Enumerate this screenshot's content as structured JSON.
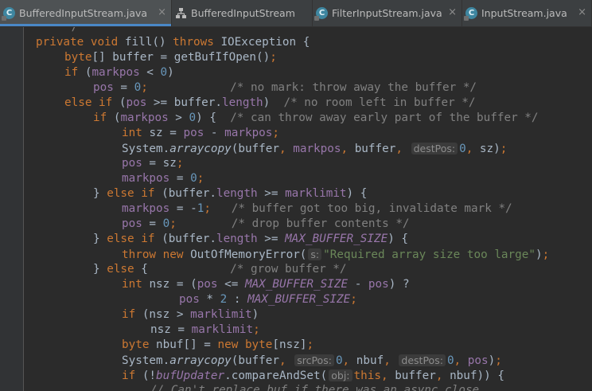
{
  "tabs": [
    {
      "label": "BufferedInputStream.java",
      "icon": "java-class-icon",
      "active": true,
      "closable": true
    },
    {
      "label": "BufferedInputStream",
      "icon": "hierarchy-icon",
      "active": false,
      "closable": false
    },
    {
      "label": "FilterInputStream.java",
      "icon": "java-class-icon",
      "active": false,
      "closable": true
    },
    {
      "label": "InputStream.java",
      "icon": "java-class-icon",
      "active": false,
      "closable": true
    }
  ],
  "close_glyph": "×",
  "colors": {
    "keyword": "#cc7832",
    "number": "#6897bb",
    "comment": "#808080",
    "string": "#6a8759",
    "field": "#9876aa",
    "text": "#a9b7c6",
    "background": "#2b2b2b"
  },
  "code": [
    {
      "indent": 2,
      "tokens": [
        {
          "t": "*/",
          "c": "cmt"
        }
      ]
    },
    {
      "indent": 1,
      "tokens": [
        {
          "t": "private void ",
          "c": "kw"
        },
        {
          "t": "fill() "
        },
        {
          "t": "throws ",
          "c": "kw"
        },
        {
          "t": "IOException {"
        }
      ]
    },
    {
      "indent": 2,
      "tokens": [
        {
          "t": "byte",
          "c": "kw"
        },
        {
          "t": "[] buffer = getBufIfOpen()"
        },
        {
          "t": ";",
          "c": "kw"
        }
      ]
    },
    {
      "indent": 2,
      "tokens": [
        {
          "t": "if ",
          "c": "kw"
        },
        {
          "t": "("
        },
        {
          "t": "markpos",
          "c": "field"
        },
        {
          "t": " < "
        },
        {
          "t": "0",
          "c": "num"
        },
        {
          "t": ")"
        }
      ]
    },
    {
      "indent": 3,
      "tokens": [
        {
          "t": "pos",
          "c": "field"
        },
        {
          "t": " = "
        },
        {
          "t": "0",
          "c": "num"
        },
        {
          "t": ";",
          "c": "kw"
        },
        {
          "t": "            "
        },
        {
          "t": "/* no mark: throw away the buffer */",
          "c": "cmt"
        }
      ]
    },
    {
      "indent": 2,
      "tokens": [
        {
          "t": "else if ",
          "c": "kw"
        },
        {
          "t": "("
        },
        {
          "t": "pos",
          "c": "field"
        },
        {
          "t": " >= buffer."
        },
        {
          "t": "length",
          "c": "field"
        },
        {
          "t": ")  "
        },
        {
          "t": "/* no room left in buffer */",
          "c": "cmt"
        }
      ]
    },
    {
      "indent": 3,
      "tokens": [
        {
          "t": "if ",
          "c": "kw"
        },
        {
          "t": "("
        },
        {
          "t": "markpos",
          "c": "field"
        },
        {
          "t": " > "
        },
        {
          "t": "0",
          "c": "num"
        },
        {
          "t": ") {  "
        },
        {
          "t": "/* can throw away early part of the buffer */",
          "c": "cmt"
        }
      ]
    },
    {
      "indent": 4,
      "tokens": [
        {
          "t": "int ",
          "c": "kw"
        },
        {
          "t": "sz = "
        },
        {
          "t": "pos",
          "c": "field"
        },
        {
          "t": " - "
        },
        {
          "t": "markpos",
          "c": "field"
        },
        {
          "t": ";",
          "c": "kw"
        }
      ]
    },
    {
      "indent": 4,
      "tokens": [
        {
          "t": "System."
        },
        {
          "t": "arraycopy",
          "c": "sm"
        },
        {
          "t": "(buffer"
        },
        {
          "t": ", ",
          "c": "kw"
        },
        {
          "t": "markpos",
          "c": "field"
        },
        {
          "t": ", ",
          "c": "kw"
        },
        {
          "t": "buffer"
        },
        {
          "t": ", ",
          "c": "kw"
        },
        {
          "t": "destPos:",
          "c": "hint"
        },
        {
          "t": "0",
          "c": "num"
        },
        {
          "t": ", ",
          "c": "kw"
        },
        {
          "t": "sz)"
        },
        {
          "t": ";",
          "c": "kw"
        }
      ]
    },
    {
      "indent": 4,
      "tokens": [
        {
          "t": "pos",
          "c": "field"
        },
        {
          "t": " = sz"
        },
        {
          "t": ";",
          "c": "kw"
        }
      ]
    },
    {
      "indent": 4,
      "tokens": [
        {
          "t": "markpos",
          "c": "field"
        },
        {
          "t": " = "
        },
        {
          "t": "0",
          "c": "num"
        },
        {
          "t": ";",
          "c": "kw"
        }
      ]
    },
    {
      "indent": 3,
      "tokens": [
        {
          "t": "} "
        },
        {
          "t": "else if ",
          "c": "kw"
        },
        {
          "t": "(buffer."
        },
        {
          "t": "length",
          "c": "field"
        },
        {
          "t": " >= "
        },
        {
          "t": "marklimit",
          "c": "field"
        },
        {
          "t": ") {"
        }
      ]
    },
    {
      "indent": 4,
      "tokens": [
        {
          "t": "markpos",
          "c": "field"
        },
        {
          "t": " = -"
        },
        {
          "t": "1",
          "c": "num"
        },
        {
          "t": ";",
          "c": "kw"
        },
        {
          "t": "   "
        },
        {
          "t": "/* buffer got too big, invalidate mark */",
          "c": "cmt"
        }
      ]
    },
    {
      "indent": 4,
      "tokens": [
        {
          "t": "pos",
          "c": "field"
        },
        {
          "t": " = "
        },
        {
          "t": "0",
          "c": "num"
        },
        {
          "t": ";",
          "c": "kw"
        },
        {
          "t": "        "
        },
        {
          "t": "/* drop buffer contents */",
          "c": "cmt"
        }
      ]
    },
    {
      "indent": 3,
      "tokens": [
        {
          "t": "} "
        },
        {
          "t": "else if ",
          "c": "kw"
        },
        {
          "t": "(buffer."
        },
        {
          "t": "length",
          "c": "field"
        },
        {
          "t": " >= "
        },
        {
          "t": "MAX_BUFFER_SIZE",
          "c": "cst"
        },
        {
          "t": ") {"
        }
      ]
    },
    {
      "indent": 4,
      "tokens": [
        {
          "t": "throw new ",
          "c": "kw"
        },
        {
          "t": "OutOfMemoryError("
        },
        {
          "t": "s:",
          "c": "hint"
        },
        {
          "t": "\"Required array size too large\"",
          "c": "str"
        },
        {
          "t": ")"
        },
        {
          "t": ";",
          "c": "kw"
        }
      ]
    },
    {
      "indent": 3,
      "tokens": [
        {
          "t": "} "
        },
        {
          "t": "else ",
          "c": "kw"
        },
        {
          "t": "{            "
        },
        {
          "t": "/* grow buffer */",
          "c": "cmt"
        }
      ]
    },
    {
      "indent": 4,
      "tokens": [
        {
          "t": "int ",
          "c": "kw"
        },
        {
          "t": "nsz = ("
        },
        {
          "t": "pos",
          "c": "field"
        },
        {
          "t": " <= "
        },
        {
          "t": "MAX_BUFFER_SIZE",
          "c": "cst"
        },
        {
          "t": " - "
        },
        {
          "t": "pos",
          "c": "field"
        },
        {
          "t": ") ?"
        }
      ]
    },
    {
      "indent": 6,
      "tokens": [
        {
          "t": "pos",
          "c": "field"
        },
        {
          "t": " * "
        },
        {
          "t": "2",
          "c": "num"
        },
        {
          "t": " : "
        },
        {
          "t": "MAX_BUFFER_SIZE",
          "c": "cst"
        },
        {
          "t": ";",
          "c": "kw"
        }
      ]
    },
    {
      "indent": 4,
      "tokens": [
        {
          "t": "if ",
          "c": "kw"
        },
        {
          "t": "(nsz > "
        },
        {
          "t": "marklimit",
          "c": "field"
        },
        {
          "t": ")"
        }
      ]
    },
    {
      "indent": 5,
      "tokens": [
        {
          "t": "nsz = "
        },
        {
          "t": "marklimit",
          "c": "field"
        },
        {
          "t": ";",
          "c": "kw"
        }
      ]
    },
    {
      "indent": 4,
      "tokens": [
        {
          "t": "byte ",
          "c": "kw"
        },
        {
          "t": "nbuf[] = "
        },
        {
          "t": "new byte",
          "c": "kw"
        },
        {
          "t": "[nsz]"
        },
        {
          "t": ";",
          "c": "kw"
        }
      ]
    },
    {
      "indent": 4,
      "tokens": [
        {
          "t": "System."
        },
        {
          "t": "arraycopy",
          "c": "sm"
        },
        {
          "t": "(buffer"
        },
        {
          "t": ", ",
          "c": "kw"
        },
        {
          "t": "srcPos:",
          "c": "hint"
        },
        {
          "t": "0",
          "c": "num"
        },
        {
          "t": ", ",
          "c": "kw"
        },
        {
          "t": "nbuf"
        },
        {
          "t": ", ",
          "c": "kw"
        },
        {
          "t": "destPos:",
          "c": "hint"
        },
        {
          "t": "0",
          "c": "num"
        },
        {
          "t": ", ",
          "c": "kw"
        },
        {
          "t": "pos",
          "c": "field"
        },
        {
          "t": ")"
        },
        {
          "t": ";",
          "c": "kw"
        }
      ]
    },
    {
      "indent": 4,
      "tokens": [
        {
          "t": "if ",
          "c": "kw"
        },
        {
          "t": "(!"
        },
        {
          "t": "bufUpdater",
          "c": "cst"
        },
        {
          "t": ".compareAndSet("
        },
        {
          "t": "obj:",
          "c": "hint"
        },
        {
          "t": "this",
          "c": "kw"
        },
        {
          "t": ", ",
          "c": "kw"
        },
        {
          "t": "buffer"
        },
        {
          "t": ", ",
          "c": "kw"
        },
        {
          "t": "nbuf)) {"
        }
      ]
    },
    {
      "indent": 5,
      "tokens": [
        {
          "t": "// Can't replace buf if there was an async close.",
          "c": "cmt ital"
        }
      ]
    }
  ]
}
